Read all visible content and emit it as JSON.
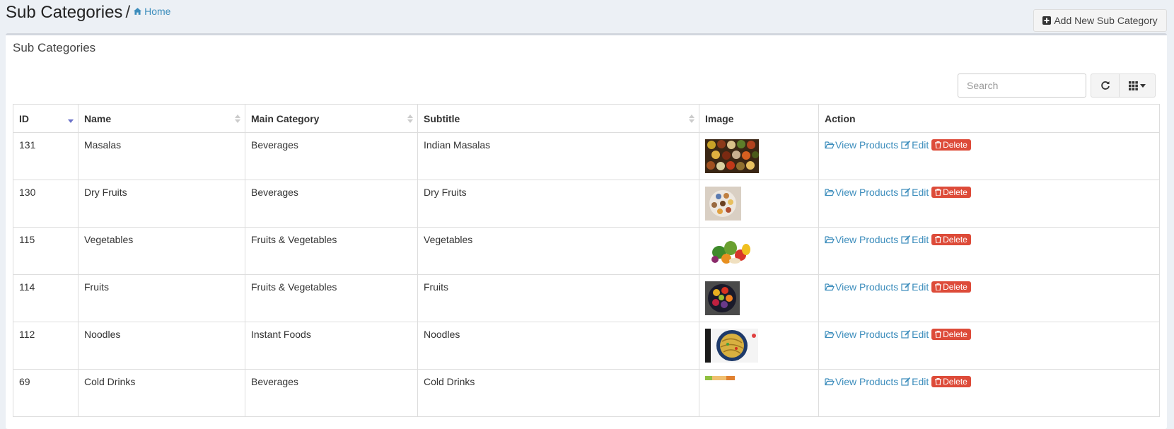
{
  "header": {
    "title": "Sub Categories",
    "separator": "/",
    "breadcrumb_home": "Home",
    "add_button_label": "Add New Sub Category"
  },
  "box": {
    "title": "Sub Categories",
    "search_placeholder": "Search"
  },
  "table": {
    "columns": [
      "ID",
      "Name",
      "Main Category",
      "Subtitle",
      "Image",
      "Action"
    ],
    "action_labels": {
      "view": "View Products",
      "edit": "Edit",
      "delete": "Delete"
    },
    "rows": [
      {
        "id": "131",
        "name": "Masalas",
        "main_category": "Beverages",
        "subtitle": "Indian Masalas",
        "image": "spices-bowls"
      },
      {
        "id": "130",
        "name": "Dry Fruits",
        "main_category": "Beverages",
        "subtitle": "Dry Fruits",
        "image": "dry-fruits-plate"
      },
      {
        "id": "115",
        "name": "Vegetables",
        "main_category": "Fruits & Vegetables",
        "subtitle": "Vegetables",
        "image": "vegetables-pile"
      },
      {
        "id": "114",
        "name": "Fruits",
        "main_category": "Fruits & Vegetables",
        "subtitle": "Fruits",
        "image": "fruit-bowl"
      },
      {
        "id": "112",
        "name": "Noodles",
        "main_category": "Instant Foods",
        "subtitle": "Noodles",
        "image": "noodles-plate"
      },
      {
        "id": "69",
        "name": "Cold Drinks",
        "main_category": "Beverages",
        "subtitle": "Cold Drinks",
        "image": "cold-drinks"
      }
    ]
  },
  "colors": {
    "link": "#3c8dbc",
    "danger": "#dd4b39",
    "sort_active": "#6b72c9",
    "page_bg": "#ecf0f5"
  },
  "icons": {
    "home": "home-icon",
    "add": "plus-square-icon",
    "refresh": "refresh-icon",
    "columns": "grid-icon",
    "view": "folder-open-icon",
    "edit": "edit-icon",
    "delete": "trash-icon"
  }
}
